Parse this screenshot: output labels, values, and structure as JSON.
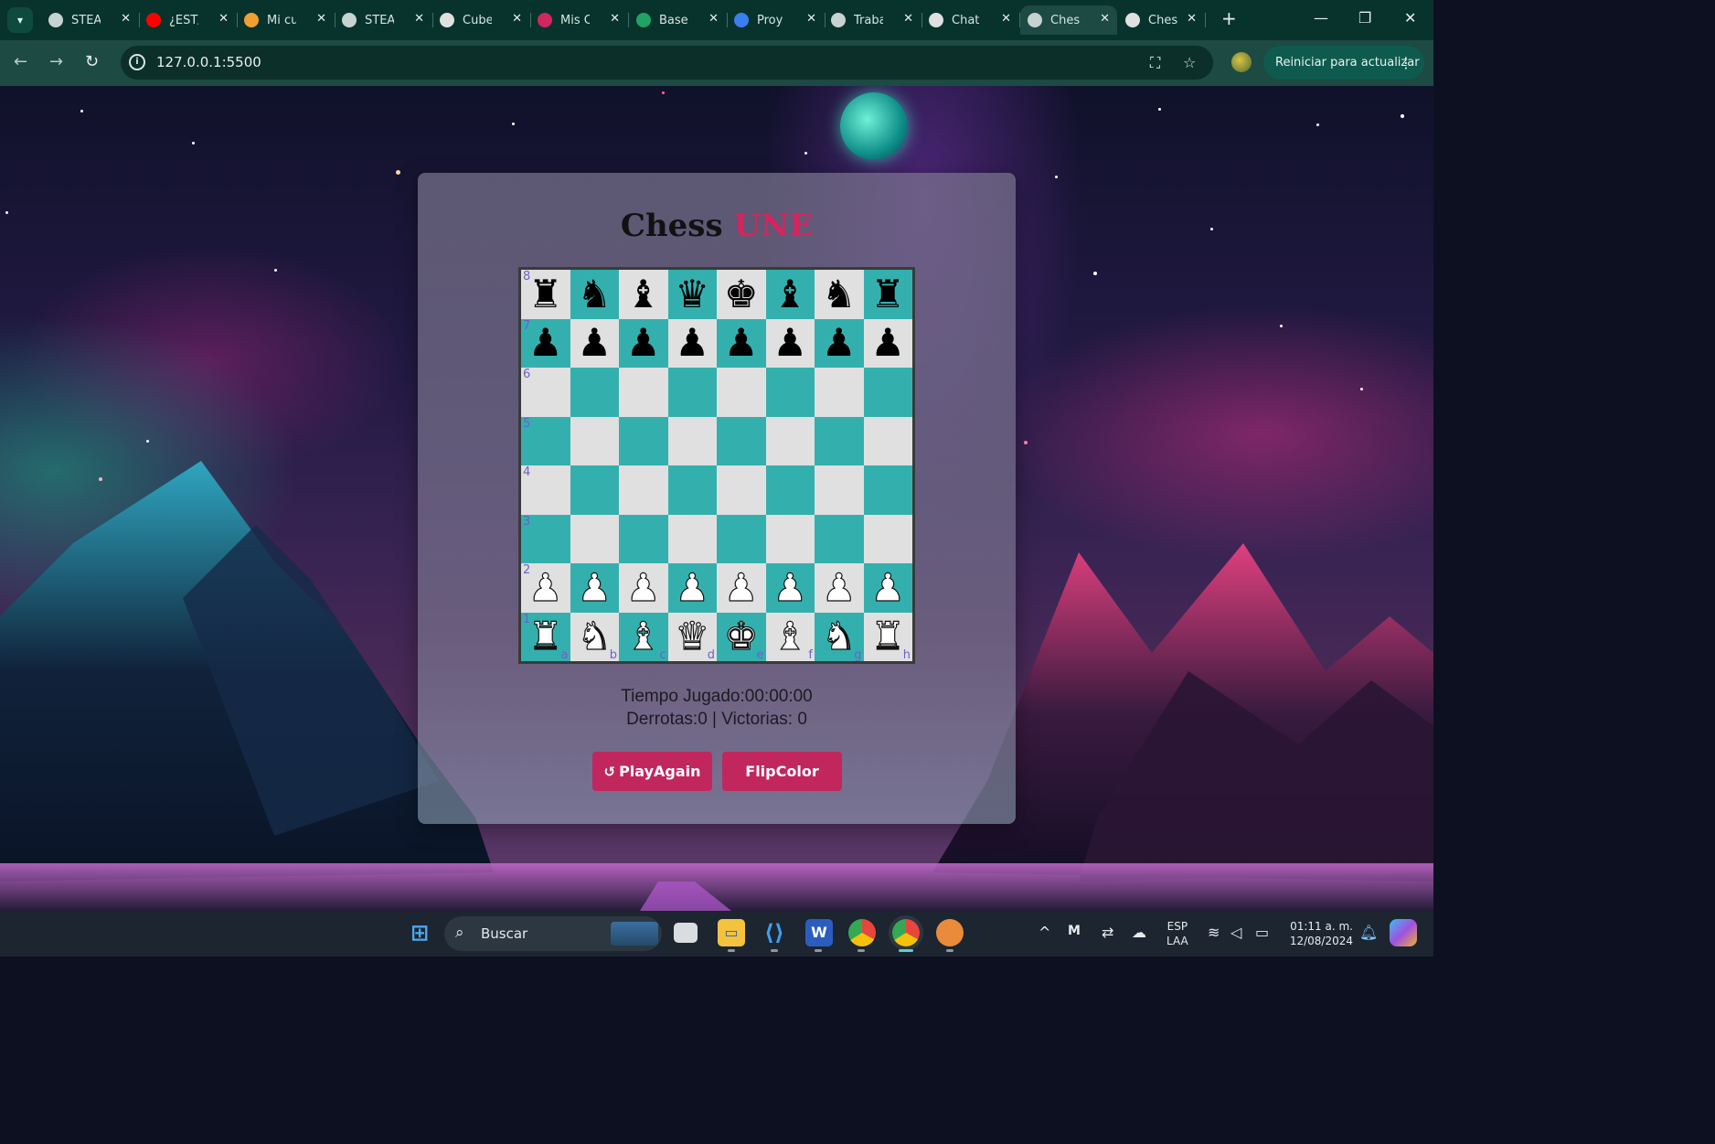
{
  "browser": {
    "tabs": [
      {
        "title": "STEA",
        "icon": "globe-icon"
      },
      {
        "title": "¿EST/",
        "icon": "youtube-icon"
      },
      {
        "title": "Mi cu",
        "icon": "brand-icon"
      },
      {
        "title": "STEA",
        "icon": "globe-icon"
      },
      {
        "title": "Cube",
        "icon": "cube-icon"
      },
      {
        "title": "Mis C",
        "icon": "une-icon"
      },
      {
        "title": "Base",
        "icon": "sheets-icon"
      },
      {
        "title": "Proy",
        "icon": "docs-icon"
      },
      {
        "title": "Traba",
        "icon": "classroom-icon"
      },
      {
        "title": "Chat",
        "icon": "chatgpt-icon"
      },
      {
        "title": "Ches",
        "icon": "globe-icon",
        "active": true
      },
      {
        "title": "Ches",
        "icon": "github-icon"
      }
    ],
    "address": "127.0.0.1:5500",
    "update_button": "Reiniciar para actualizar"
  },
  "app": {
    "title_main": "Chess",
    "title_accent": "UNE",
    "accent_color": "#d1265f",
    "light_square": "#e0e0e0",
    "dark_square": "#33b0ae",
    "time_played": "Tiempo Jugado:00:00:00",
    "record": "Derrotas:0 | Victorias: 0",
    "play_again_label": "PlayAgain",
    "flip_color_label": "FlipColor"
  },
  "board": {
    "ranks": [
      [
        "r",
        "n",
        "b",
        "q",
        "k",
        "b",
        "n",
        "r"
      ],
      [
        "p",
        "p",
        "p",
        "p",
        "p",
        "p",
        "p",
        "p"
      ],
      [
        "",
        "",
        "",
        "",
        "",
        "",
        "",
        ""
      ],
      [
        "",
        "",
        "",
        "",
        "",
        "",
        "",
        ""
      ],
      [
        "",
        "",
        "",
        "",
        "",
        "",
        "",
        ""
      ],
      [
        "",
        "",
        "",
        "",
        "",
        "",
        "",
        ""
      ],
      [
        "P",
        "P",
        "P",
        "P",
        "P",
        "P",
        "P",
        "P"
      ],
      [
        "R",
        "N",
        "B",
        "Q",
        "K",
        "B",
        "N",
        "R"
      ]
    ],
    "rank_labels": [
      "8",
      "7",
      "6",
      "5",
      "4",
      "3",
      "2",
      "1"
    ],
    "file_labels": [
      "a",
      "b",
      "c",
      "d",
      "e",
      "f",
      "g",
      "h"
    ]
  },
  "taskbar": {
    "search_placeholder": "Buscar",
    "language": "ESP",
    "layout": "LAA",
    "time": "01:11 a. m.",
    "date": "12/08/2024"
  }
}
